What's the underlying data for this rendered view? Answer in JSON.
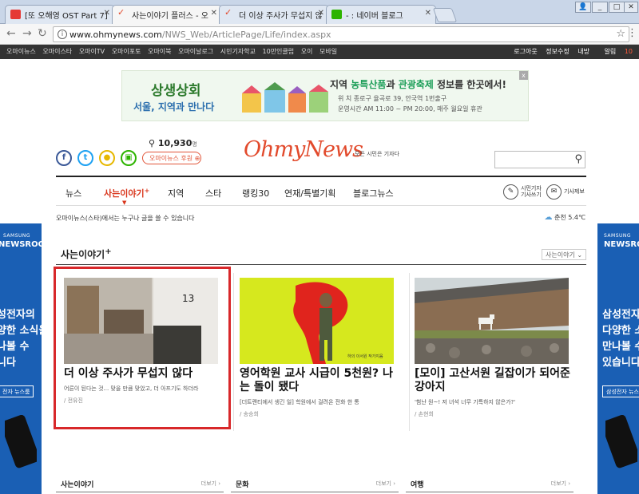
{
  "browser": {
    "tabs": [
      {
        "title": "[또 오해영 OST Part 7]",
        "color": "#e53935"
      },
      {
        "title": "사는이야기 플러스 - 오",
        "color": "#e24a2c"
      },
      {
        "title": "더 이상 주사가 무섭지 않",
        "color": "#e24a2c"
      },
      {
        "title": "- : 네이버 블로그",
        "color": "#2db400"
      }
    ],
    "url_host": "www.ohmynews.com",
    "url_path": "/NWS_Web/ArticlePage/Life/index.aspx"
  },
  "sitebar": {
    "links": [
      "오마이뉴스",
      "오마이스타",
      "오마이TV",
      "오마이포토",
      "오마이북",
      "오마이날로그",
      "시민기자학교",
      "10만인클럽",
      "오이",
      "모바일"
    ],
    "right": [
      "로그아웃",
      "정보수정",
      "내방",
      "알림"
    ],
    "alert_count": "10"
  },
  "banner": {
    "title": "상생상회",
    "subtitle": "서울, 지역과 만나다",
    "headline_pre": "지역 ",
    "headline_green": "농특산품",
    "headline_mid": "과 ",
    "headline_green2": "관광축제",
    "headline_post": " 정보를 한곳에서!",
    "info_location": "위    치  종로구 율곡로 39, 안국역 1번출구",
    "info_hours": "운영시간  AM 11:00 ~ PM 20:00, 매주 월요일 휴관",
    "close": "x"
  },
  "header": {
    "counter": "10,930",
    "counter_unit": "명",
    "support_label": "오마이뉴스 후원",
    "logo": "OhmyNews",
    "tagline": "모든 시민은 기자다"
  },
  "mainnav": {
    "items": [
      "뉴스",
      "사는이야기",
      "지역",
      "스타",
      "랭킹30",
      "연재/특별기획",
      "블로그뉴스"
    ],
    "plus": "+",
    "citizen_reporter": [
      "시민기자",
      "기사쓰기"
    ],
    "tip": "기사제보"
  },
  "notice": "오마이뉴스(스타)에서는 누구나 글을 쓸 수 있습니다",
  "weather": "춘천 5.4℃",
  "sidead": {
    "brand": "SAMSUNG",
    "brand2": "NEWSROOM",
    "left_copy": [
      "성전자의",
      "양한 소식을",
      "나볼 수",
      "니다"
    ],
    "left_cta": "전자 뉴스룸",
    "right_copy": [
      "삼성전자",
      "다양한 소",
      "만나볼 수",
      "있습니다"
    ],
    "right_cta": "삼성전자 뉴스"
  },
  "section": {
    "title": "사는이야기",
    "plus": "+",
    "dropdown": "사는이야기"
  },
  "articles": [
    {
      "title": "더 이상 주사가 무섭지 않다",
      "desc": "어른이 된다는 것... 맞을 만큼 맞았고, 더 아프기도 하더라",
      "byline": "/ 전유진"
    },
    {
      "title": "영어학원 교사 시급이 5천원? 나는 돌이 됐다",
      "desc": "[더트랜티에서 생긴 일] 학원에서 걸려온 전화 한 통",
      "byline": "/ 송승희"
    },
    {
      "title": "[모이] 고산서원 길잡이가 되어준 강아지",
      "desc": "'험난 원~! 저 녀석 너무 기특하지 않은가?'",
      "byline": "/ 손현희"
    }
  ],
  "bottom_sections": [
    {
      "title": "사는이야기",
      "more": "더보기"
    },
    {
      "title": "문화",
      "more": "더보기"
    },
    {
      "title": "여행",
      "more": "더보기"
    }
  ]
}
